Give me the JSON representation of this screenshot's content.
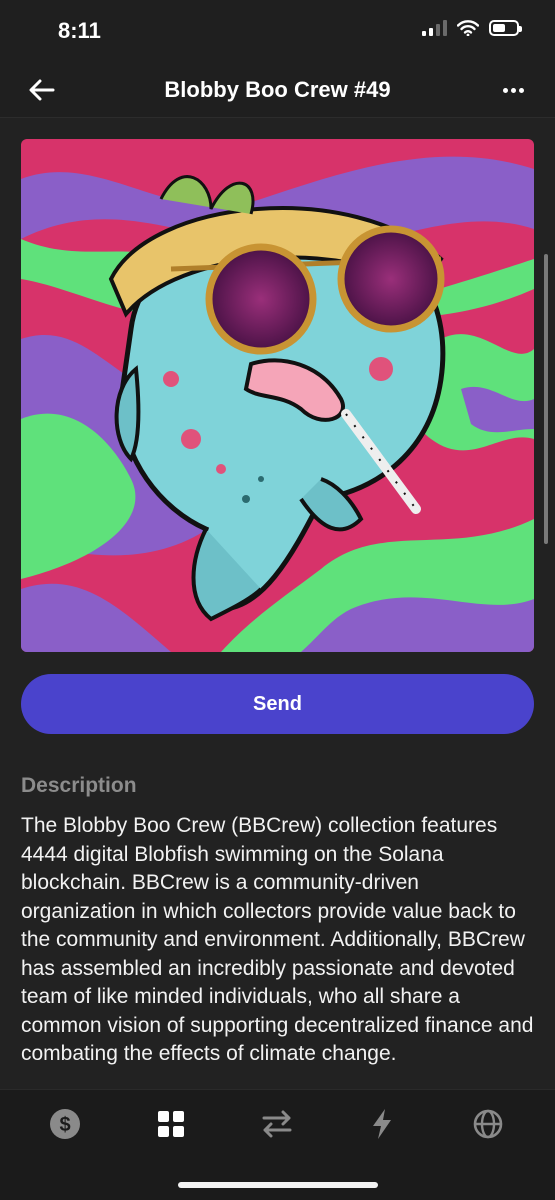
{
  "status_bar": {
    "time": "8:11"
  },
  "nav": {
    "title": "Blobby Boo Crew #49",
    "back_icon": "arrow-left-icon",
    "more_icon": "more-horizontal-icon"
  },
  "nft": {
    "image_alt_icon": "nft-artwork-blobfish"
  },
  "actions": {
    "send_label": "Send"
  },
  "description": {
    "label": "Description",
    "text": "The Blobby Boo Crew (BBCrew) collection features 4444 digital Blobfish swimming on the Solana blockchain. BBCrew is a community-driven organization in which collectors provide value back to the community and environment. Additionally, BBCrew has assembled an incredibly passionate and devoted team of like minded individuals, who all share a common vision of supporting decentralized finance and combating the effects of climate change."
  },
  "tab_bar": {
    "tabs": [
      {
        "icon": "dollar-icon",
        "active": false
      },
      {
        "icon": "collectibles-grid-icon",
        "active": true
      },
      {
        "icon": "swap-icon",
        "active": false
      },
      {
        "icon": "lightning-icon",
        "active": false
      },
      {
        "icon": "globe-icon",
        "active": false
      }
    ]
  },
  "colors": {
    "accent": "#4a43cc",
    "background": "#222222",
    "muted": "#8c8c8c"
  }
}
